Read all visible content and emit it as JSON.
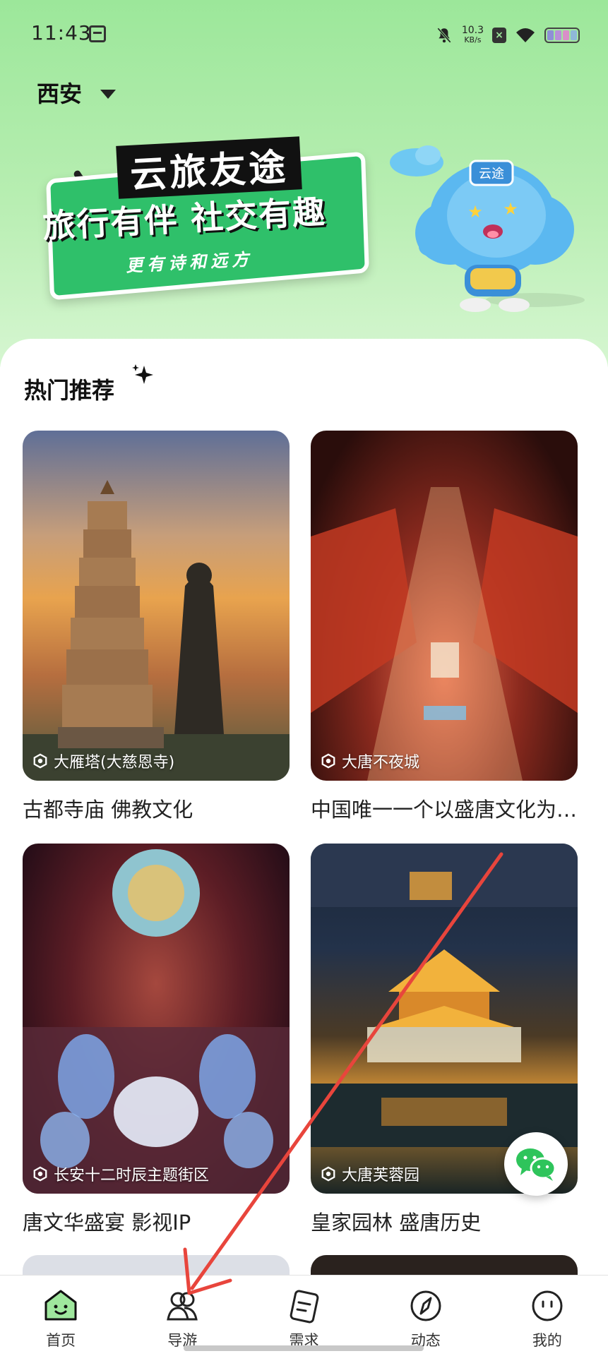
{
  "status_bar": {
    "time": "11:43",
    "net_speed_value": "10.3",
    "net_speed_unit": "KB/s"
  },
  "header": {
    "city": "西安"
  },
  "banner": {
    "line1": "云旅友途",
    "line2": "旅行有伴 社交有趣",
    "line3": "更有诗和远方",
    "mascot_badge": "云途"
  },
  "section": {
    "title": "热门推荐"
  },
  "cards": [
    {
      "tag": "大雁塔(大慈恩寺)",
      "title": "古都寺庙 佛教文化"
    },
    {
      "tag": "大唐不夜城",
      "title": "中国唯一一个以盛唐文化为背景的步行街"
    },
    {
      "tag": "长安十二时辰主题街区",
      "title": "唐文华盛宴 影视IP"
    },
    {
      "tag": "大唐芙蓉园",
      "title": "皇家园林 盛唐历史"
    }
  ],
  "bottom_nav": {
    "items": [
      {
        "label": "首页",
        "icon": "home-face-icon"
      },
      {
        "label": "导游",
        "icon": "users-icon"
      },
      {
        "label": "需求",
        "icon": "document-icon"
      },
      {
        "label": "动态",
        "icon": "compass-icon"
      },
      {
        "label": "我的",
        "icon": "profile-face-icon"
      }
    ]
  },
  "colors": {
    "accent": "#2fc06a",
    "header_bg": "#9ce79a",
    "annotation_arrow": "#e8453c"
  }
}
